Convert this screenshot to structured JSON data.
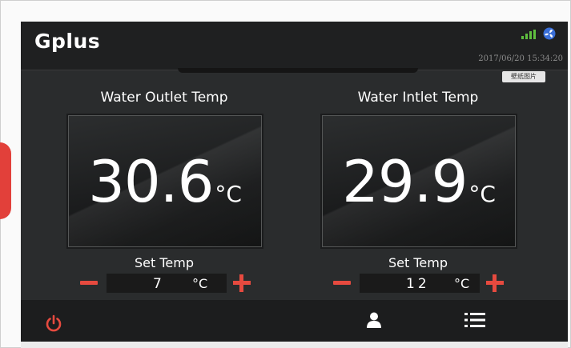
{
  "header": {
    "logo": "Gplus",
    "datetime": "2017/06/20 15:34:20",
    "tag_label": "壁纸图片"
  },
  "outlet": {
    "title": "Water Outlet Temp",
    "value": "30.6",
    "unit": "°C",
    "set_label": "Set Temp",
    "set_value": "7",
    "set_unit": "°C"
  },
  "inlet": {
    "title": "Water Intlet Temp",
    "value": "29.9",
    "unit": "°C",
    "set_label": "Set Temp",
    "set_value": "12",
    "set_unit": "°C"
  },
  "icons": {
    "signal": "signal-icon",
    "fan": "fan-icon",
    "power": "power-icon",
    "user": "user-icon",
    "menu": "menu-icon"
  },
  "colors": {
    "accent": "#e64a3f",
    "screen_bg": "#2a2c2d"
  }
}
